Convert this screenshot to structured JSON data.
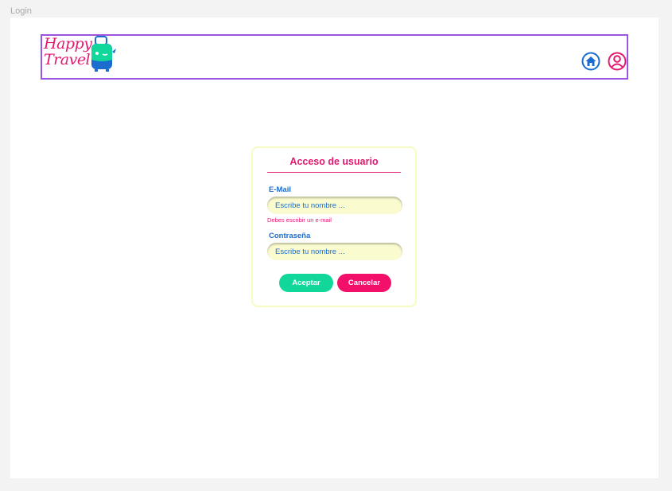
{
  "frame": {
    "label": "Login"
  },
  "header": {
    "logo": {
      "line1": "Happy",
      "line2": "Travel"
    },
    "icons": [
      "home-icon",
      "user-profile-icon"
    ]
  },
  "login": {
    "title": "Acceso de usuario",
    "email": {
      "label": "E-Mail",
      "placeholder": "Escribe tu nombre ...",
      "error": "Debes escribir un e-mail"
    },
    "password": {
      "label": "Contraseña",
      "placeholder": "Escribe tu nombre ..."
    },
    "accept_label": "Aceptar",
    "cancel_label": "Cancelar"
  },
  "colors": {
    "brand_pink": "#e3196f",
    "brand_blue": "#1a6ccf",
    "accept_green": "#11d79a",
    "cancel_pink": "#f2106a",
    "header_border": "#9b55e0",
    "input_bg": "#fbfbd0"
  }
}
